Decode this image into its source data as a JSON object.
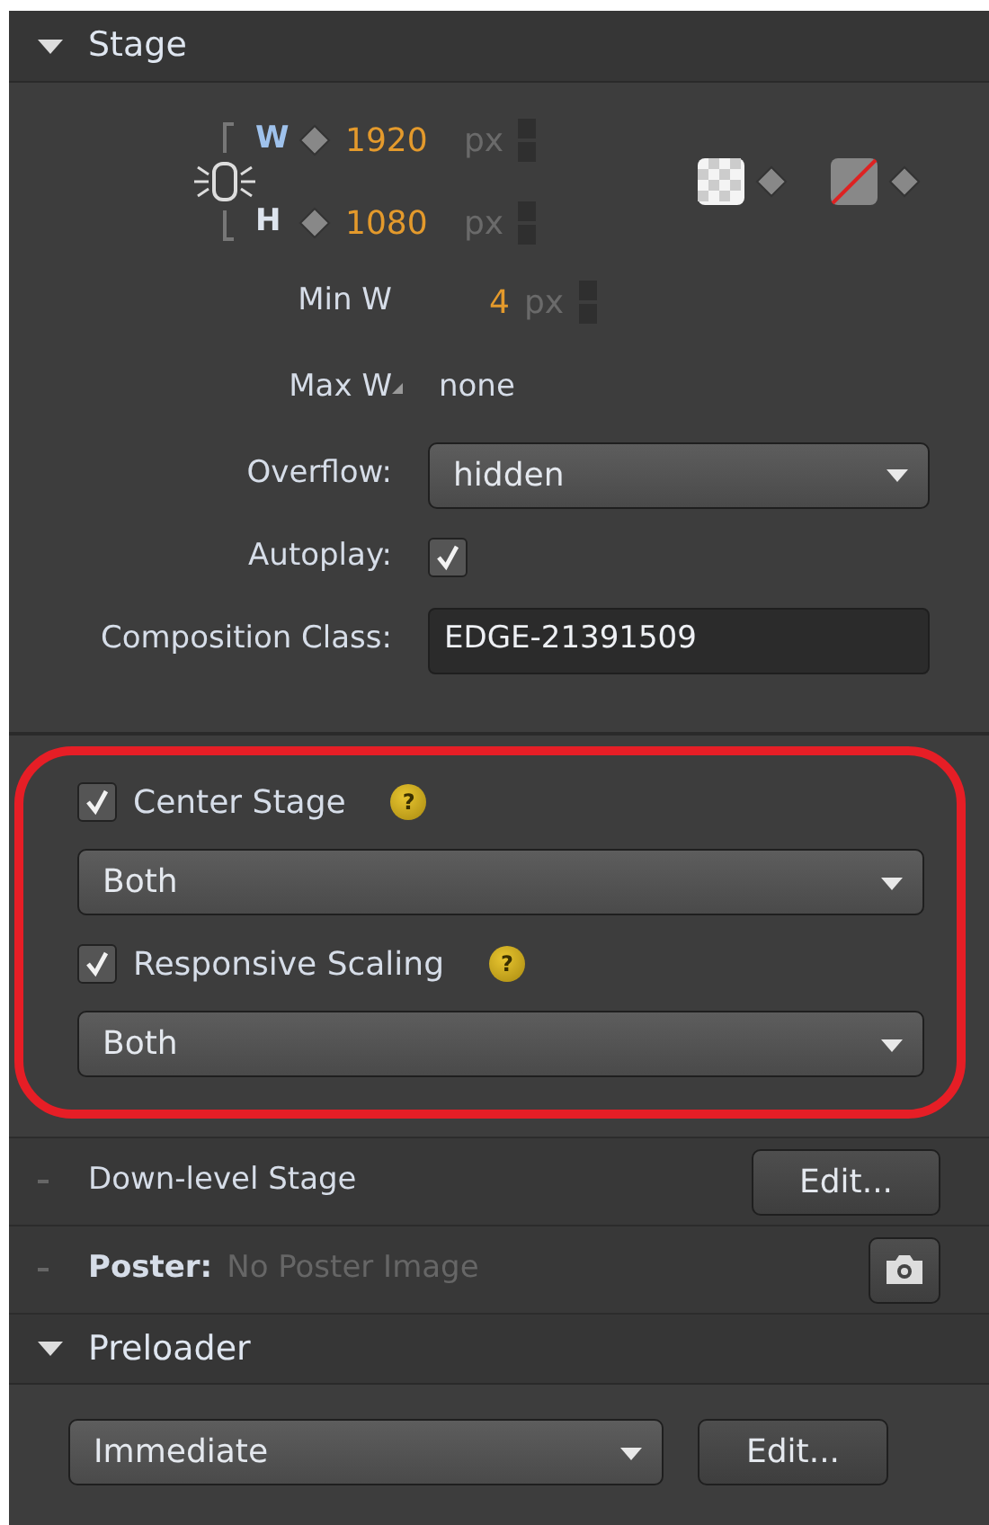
{
  "stage": {
    "title": "Stage",
    "expanded": true,
    "width": {
      "label": "W",
      "value": "1920",
      "unit": "px"
    },
    "height": {
      "label": "H",
      "value": "1080",
      "unit": "px"
    },
    "min_width": {
      "label": "Min W",
      "value": "4",
      "unit": "px"
    },
    "max_width": {
      "label": "Max W",
      "value": "none"
    },
    "overflow": {
      "label": "Overflow:",
      "value": "hidden"
    },
    "autoplay": {
      "label": "Autoplay:",
      "checked": true
    },
    "composition_class": {
      "label": "Composition Class:",
      "value": "EDGE-21391509"
    },
    "options": [
      {
        "label": "Center Stage",
        "checked": true,
        "help": "?",
        "value": "Both"
      },
      {
        "label": "Responsive Scaling",
        "checked": true,
        "help": "?",
        "value": "Both"
      }
    ]
  },
  "down_level_stage": {
    "title": "Down-level Stage",
    "expanded": false,
    "button": "Edit..."
  },
  "poster": {
    "label": "Poster:",
    "value": "No Poster Image",
    "expanded": false
  },
  "preloader": {
    "title": "Preloader",
    "expanded": true,
    "mode": "Immediate",
    "button": "Edit..."
  }
}
